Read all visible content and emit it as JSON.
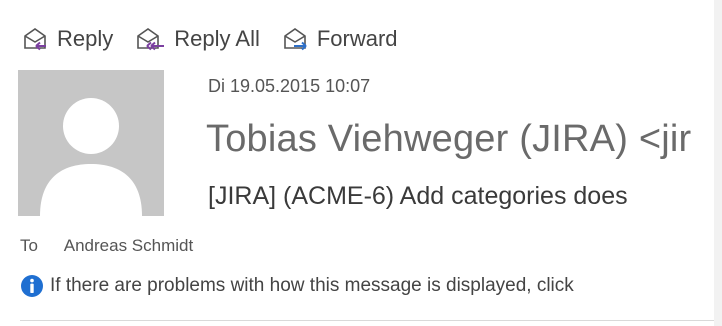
{
  "toolbar": {
    "reply_label": "Reply",
    "reply_all_label": "Reply All",
    "forward_label": "Forward"
  },
  "message": {
    "date": "Di 19.05.2015 10:07",
    "sender": "Tobias Viehweger (JIRA) <jir",
    "subject": "[JIRA] (ACME-6) Add categories does",
    "to_label": "To",
    "to_value": "Andreas Schmidt",
    "info_text": "If there are problems with how this message is displayed, click"
  },
  "colors": {
    "reply_arrow": "#7b3fa0",
    "forward_arrow": "#2e6fc7",
    "info_icon": "#1f6fd1",
    "avatar_bg": "#c6c6c6"
  },
  "icons": {
    "reply": "reply-icon",
    "reply_all": "reply-all-icon",
    "forward": "forward-icon",
    "avatar": "avatar-placeholder-icon",
    "info": "info-icon"
  }
}
